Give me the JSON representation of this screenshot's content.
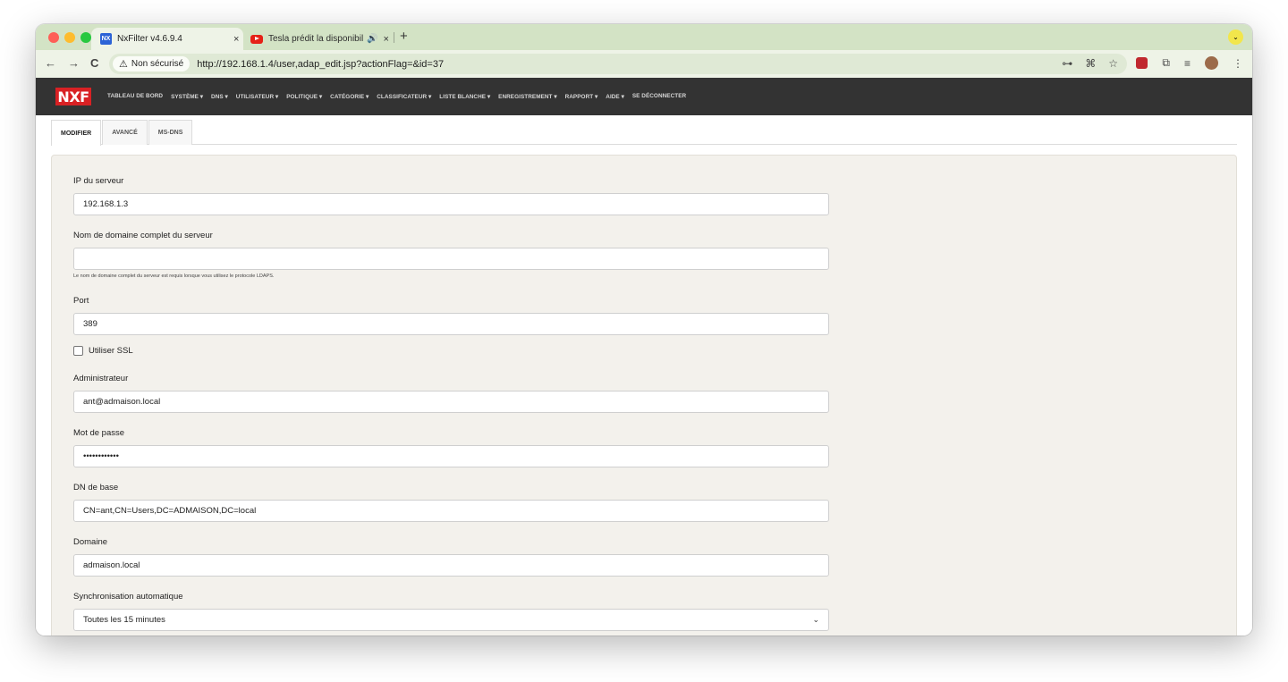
{
  "browser": {
    "tabs": [
      {
        "favicon": "nxfilter-logo-icon",
        "favicon_text": "NX",
        "title": "NxFilter v4.6.9.4",
        "close": "×"
      },
      {
        "favicon": "youtube-icon",
        "title": "Tesla prédit la disponibilité",
        "audio": "🔊",
        "close": "×"
      }
    ],
    "new_tab": "+",
    "security_label": "Non sécurisé",
    "url": "http://192.168.1.4/user,adap_edit.jsp?actionFlag=&id=37"
  },
  "app": {
    "logo": "NXF",
    "menu": [
      "TABLEAU DE BORD",
      "SYSTÈME ▾",
      "DNS ▾",
      "UTILISATEUR ▾",
      "POLITIQUE ▾",
      "CATÉGORIE ▾",
      "CLASSIFICATEUR ▾",
      "LISTE BLANCHE ▾",
      "ENREGISTREMENT ▾",
      "RAPPORT ▾",
      "AIDE ▾",
      "SE DÉCONNECTER"
    ],
    "tabs": [
      "MODIFIER",
      "AVANCÉ",
      "MS-DNS"
    ]
  },
  "form": {
    "server_ip": {
      "label": "IP du serveur",
      "value": "192.168.1.3"
    },
    "fqdn": {
      "label": "Nom de domaine complet du serveur",
      "value": "",
      "help": "Le nom de domaine complet du serveur est requis lorsque vous utilisez le protocole LDAPS."
    },
    "port": {
      "label": "Port",
      "value": "389"
    },
    "use_ssl": {
      "label": "Utiliser SSL",
      "checked": false
    },
    "admin": {
      "label": "Administrateur",
      "value": "ant@admaison.local"
    },
    "password": {
      "label": "Mot de passe",
      "value": "••••••••••••"
    },
    "base_dn": {
      "label": "DN de base",
      "value": "CN=ant,CN=Users,DC=ADMAISON,DC=local"
    },
    "domain": {
      "label": "Domaine",
      "value": "admaison.local"
    },
    "auto_sync": {
      "label": "Synchronisation automatique",
      "value": "Toutes les 15 minutes"
    }
  },
  "colors": {
    "header_bg": "#333333",
    "logo_bg": "#d92124",
    "panel_bg": "#f3f1ec",
    "tabstrip": "#d3e3c5"
  }
}
